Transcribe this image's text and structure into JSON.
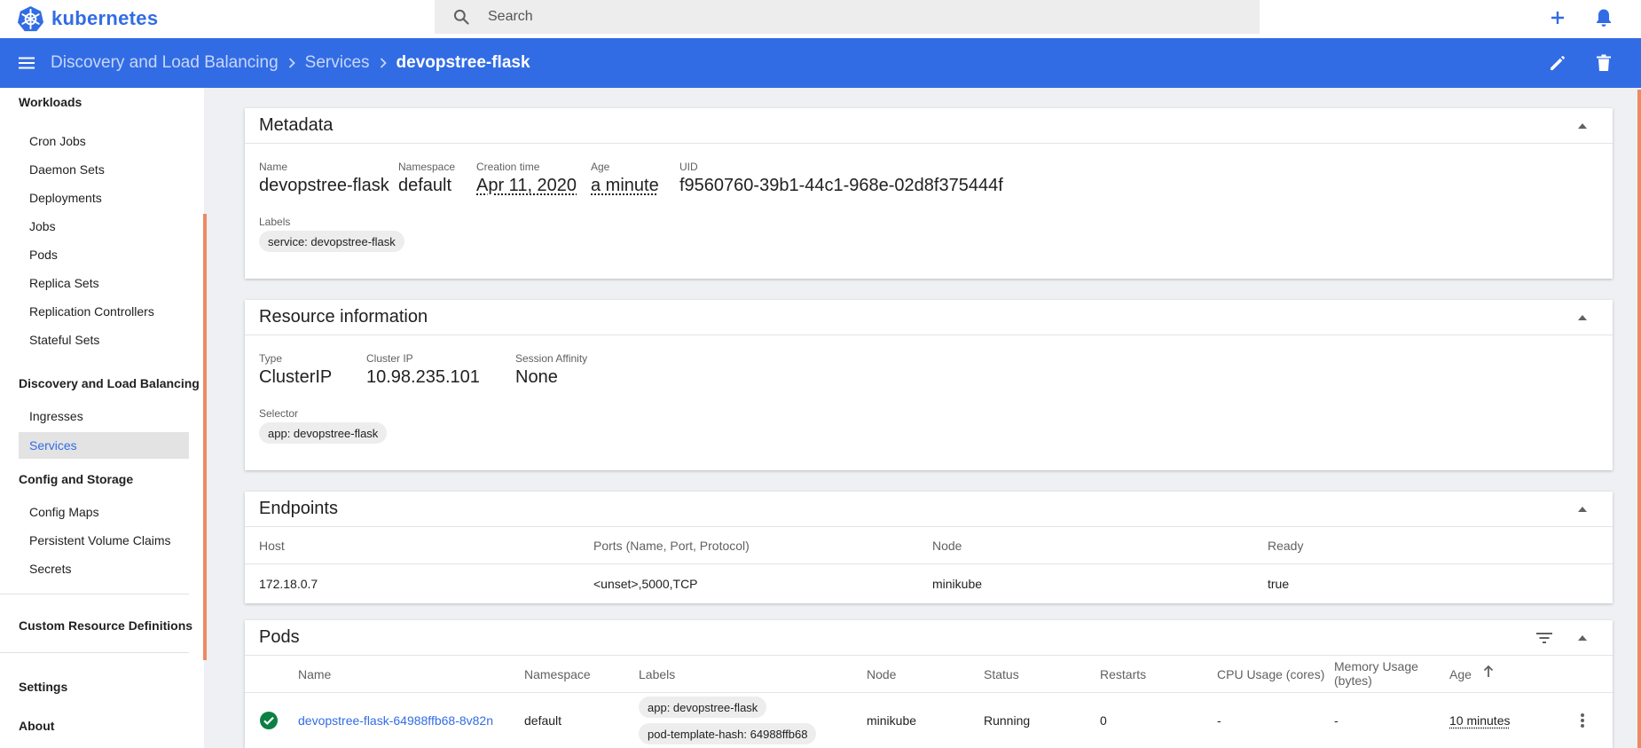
{
  "app": {
    "name": "kubernetes",
    "brand_color": "#326ce5"
  },
  "search": {
    "placeholder": "Search"
  },
  "breadcrumb": {
    "items": [
      "Discovery and Load Balancing",
      "Services"
    ],
    "current": "devopstree-flask"
  },
  "sidebar": {
    "workloads": {
      "title": "Workloads",
      "items": [
        "Cron Jobs",
        "Daemon Sets",
        "Deployments",
        "Jobs",
        "Pods",
        "Replica Sets",
        "Replication Controllers",
        "Stateful Sets"
      ]
    },
    "discovery": {
      "title": "Discovery and Load Balancing",
      "items": [
        "Ingresses",
        "Services"
      ],
      "active": "Services"
    },
    "config": {
      "title": "Config and Storage",
      "items": [
        "Config Maps",
        "Persistent Volume Claims",
        "Secrets"
      ]
    },
    "crd": "Custom Resource Definitions",
    "settings": "Settings",
    "about": "About"
  },
  "metadata": {
    "title": "Metadata",
    "name_label": "Name",
    "name": "devopstree-flask",
    "namespace_label": "Namespace",
    "namespace": "default",
    "creation_label": "Creation time",
    "creation": "Apr 11, 2020",
    "age_label": "Age",
    "age": "a minute",
    "uid_label": "UID",
    "uid": "f9560760-39b1-44c1-968e-02d8f375444f",
    "labels_label": "Labels",
    "labels": [
      "service: devopstree-flask"
    ]
  },
  "resource": {
    "title": "Resource information",
    "type_label": "Type",
    "type": "ClusterIP",
    "cluster_ip_label": "Cluster IP",
    "cluster_ip": "10.98.235.101",
    "affinity_label": "Session Affinity",
    "affinity": "None",
    "selector_label": "Selector",
    "selector": [
      "app: devopstree-flask"
    ]
  },
  "endpoints": {
    "title": "Endpoints",
    "columns": [
      "Host",
      "Ports (Name, Port, Protocol)",
      "Node",
      "Ready"
    ],
    "rows": [
      [
        "172.18.0.7",
        "<unset>,5000,TCP",
        "minikube",
        "true"
      ]
    ]
  },
  "pods": {
    "title": "Pods",
    "columns": [
      "Name",
      "Namespace",
      "Labels",
      "Node",
      "Status",
      "Restarts",
      "CPU Usage (cores)",
      "Memory Usage (bytes)",
      "Age"
    ],
    "rows": [
      {
        "name": "devopstree-flask-64988ffb68-8v82n",
        "namespace": "default",
        "labels": [
          "app: devopstree-flask",
          "pod-template-hash: 64988ffb68"
        ],
        "node": "minikube",
        "status": "Running",
        "restarts": "0",
        "cpu": "-",
        "memory": "-",
        "age": "10 minutes"
      }
    ]
  }
}
